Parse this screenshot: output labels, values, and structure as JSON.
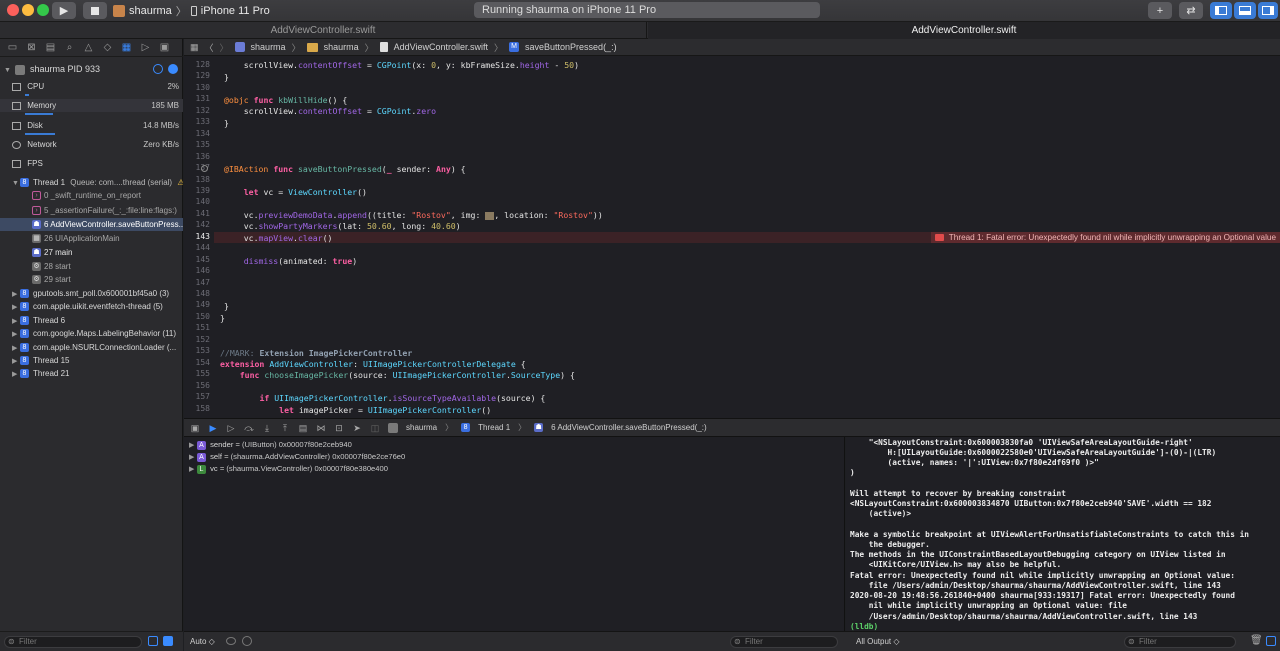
{
  "toolbar": {
    "scheme": "shaurma",
    "device": "iPhone 11 Pro",
    "status": "Running shaurma on iPhone 11 Pro",
    "colors": {
      "close": "#fc605b",
      "minimize": "#fdbc40",
      "zoom": "#34c84a"
    }
  },
  "tabs": [
    {
      "label": "AddViewController.swift"
    },
    {
      "label": "AddViewController.swift"
    }
  ],
  "navigator": {
    "process": "shaurma PID 933",
    "gauges": [
      {
        "label": "CPU",
        "value": "2%"
      },
      {
        "label": "Memory",
        "value": "185 MB"
      },
      {
        "label": "Disk",
        "value": "14.8 MB/s"
      },
      {
        "label": "Network",
        "value": "Zero KB/s"
      },
      {
        "label": "FPS",
        "value": ""
      }
    ],
    "thread1": "Thread 1",
    "thread1_queue": "Queue: com....thread (serial)",
    "frames": [
      "0 _swift_runtime_on_report",
      "5 _assertionFailure(_:_:file:line:flags:)",
      "6 AddViewController.saveButtonPress...",
      "26 UIApplicationMain",
      "27 main",
      "28 start",
      "29 start"
    ],
    "threads": [
      "gputools.smt_poll.0x600001bf45a0 (3)",
      "com.apple.uikit.eventfetch-thread (5)",
      "Thread 6",
      "com.google.Maps.LabelingBehavior (11)",
      "com.apple.NSURLConnectionLoader (...",
      "Thread 15",
      "Thread 21"
    ],
    "filter_placeholder": "Filter"
  },
  "jumpbar": [
    "shaurma",
    "shaurma",
    "AddViewController.swift",
    "saveButtonPressed(_:)"
  ],
  "editor": {
    "line_numbers": [
      "128",
      "129",
      "130",
      "131",
      "132",
      "133",
      "134",
      "135",
      "136",
      "137",
      "138",
      "139",
      "140",
      "141",
      "142",
      "143",
      "144",
      "145",
      "146",
      "147",
      "148",
      "149",
      "150",
      "151",
      "152",
      "153",
      "154",
      "155",
      "156",
      "157",
      "158"
    ],
    "error": "Thread 1: Fatal error: Unexpectedly found nil while implicitly unwrapping an Optional value"
  },
  "debugbar": {
    "breadcrumb": [
      "shaurma",
      "Thread 1",
      "6 AddViewController.saveButtonPressed(_:)"
    ]
  },
  "variables": [
    {
      "badge": "A",
      "name": "sender",
      "value": "= (UIButton) 0x00007f80e2ceb940"
    },
    {
      "badge": "A",
      "name": "self",
      "value": "= (shaurma.AddViewController) 0x00007f80e2ce76e0"
    },
    {
      "badge": "L",
      "name": "vc",
      "value": "= (shaurma.ViewController) 0x00007f80e380e400"
    }
  ],
  "console": [
    "    \"<NSLayoutConstraint:0x600003830fa0 'UIViewSafeAreaLayoutGuide-right'",
    "        H:[UILayoutGuide:0x6000022580e0'UIViewSafeAreaLayoutGuide']-(0)-|(LTR)",
    "        (active, names: '|':UIView:0x7f80e2df69f0 )>\"",
    ")",
    "",
    "Will attempt to recover by breaking constraint",
    "<NSLayoutConstraint:0x600003834870 UIButton:0x7f80e2ceb940'SAVE'.width == 182",
    "    (active)>",
    "",
    "Make a symbolic breakpoint at UIViewAlertForUnsatisfiableConstraints to catch this in",
    "    the debugger.",
    "The methods in the UIConstraintBasedLayoutDebugging category on UIView listed in",
    "    <UIKitCore/UIView.h> may also be helpful.",
    "Fatal error: Unexpectedly found nil while implicitly unwrapping an Optional value:",
    "    file /Users/admin/Desktop/shaurma/shaurma/AddViewController.swift, line 143",
    "2020-08-20 19:48:56.261840+0400 shaurma[933:19317] Fatal error: Unexpectedly found",
    "    nil while implicitly unwrapping an Optional value: file",
    "    /Users/admin/Desktop/shaurma/shaurma/AddViewController.swift, line 143",
    "(lldb)"
  ],
  "bottombar": {
    "auto": "Auto ◇",
    "filter_placeholder": "Filter",
    "output": "All Output ◇"
  }
}
